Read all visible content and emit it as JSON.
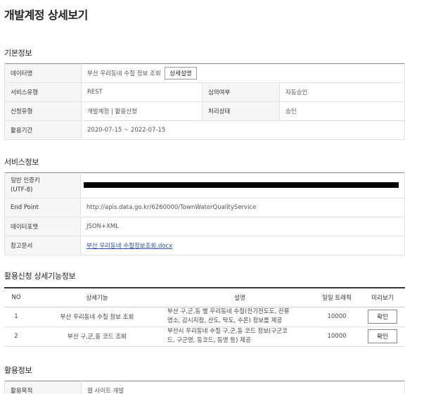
{
  "page_title": "개발계정 상세보기",
  "basic": {
    "section_title": "기본정보",
    "data_name_label": "데이터명",
    "data_name_value": "부산 우리동네 수질 정보 조회",
    "detail_button": "상세설명",
    "service_type_label": "서비스유형",
    "service_type_value": "REST",
    "review_label": "심의여부",
    "review_value": "자동승인",
    "request_label": "신청유형",
    "request_value": "개발계정 | 활용신청",
    "status_label": "처리상태",
    "status_value": "승인",
    "period_label": "활용기간",
    "period_value": "2020-07-15 ~ 2022-07-15"
  },
  "service": {
    "section_title": "서비스정보",
    "key_label_line1": "일반 인증키",
    "key_label_line2": "(UTF-8)",
    "endpoint_label": "End Point",
    "endpoint_value": "http://apis.data.go.kr/6260000/TownWaterQualityService",
    "format_label": "데이터포맷",
    "format_value": "JSON+XML",
    "reference_label": "참고문서",
    "reference_value": "부산 우리동네 수질정보조회.docx"
  },
  "functions": {
    "section_title": "활용신청 상세기능정보",
    "headers": [
      "NO",
      "상세기능",
      "설명",
      "일일 트래픽",
      "미리보기"
    ],
    "rows": [
      {
        "no": "1",
        "name": "부산 우리동네 수질 정보 조회",
        "desc_line1": "부산 구,군,동 별 우리동네 수질(전기전도도, 잔류",
        "desc_line2": "염소, 감시지점, 산도, 탁도, 수온) 정보를 제공",
        "traffic": "10000",
        "button": "확인"
      },
      {
        "no": "2",
        "name": "부산 구,군,동 코드 조회",
        "desc_line1": "부산시 우리동네 수질 구,군,동 코드 정보(구군코",
        "desc_line2": "드, 구군명, 동코드, 동명 등) 제공",
        "traffic": "10000",
        "button": "확인"
      }
    ]
  },
  "usage": {
    "section_title": "활용정보",
    "purpose_label": "활용목적",
    "purpose_value": "웹 사이트 개발"
  }
}
